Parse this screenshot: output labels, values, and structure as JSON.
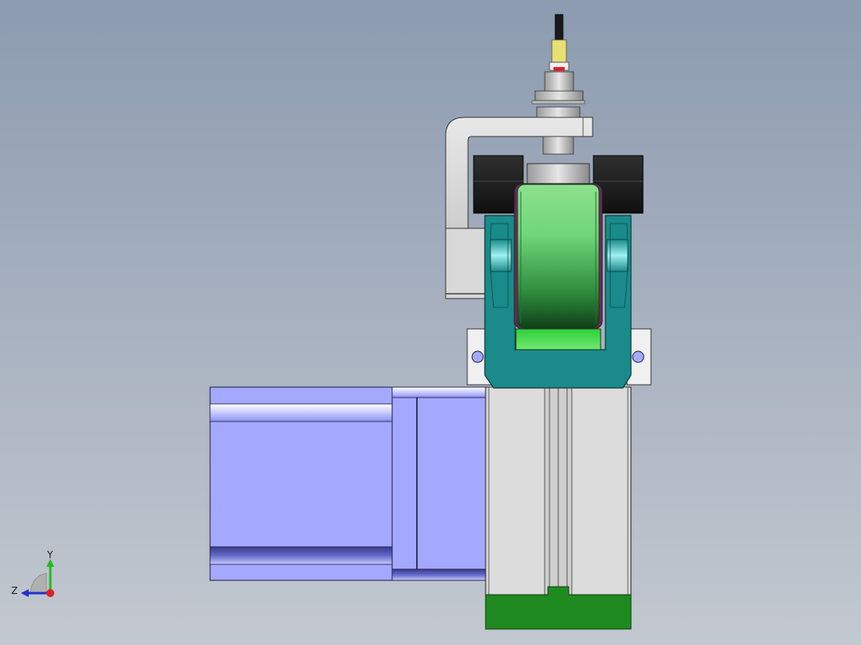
{
  "viewport": {
    "background_top": "#8c9bb0",
    "background_bottom": "#c3c8d0"
  },
  "model": {
    "parts": [
      "motor",
      "linear-module",
      "wheel-bracket",
      "polyurethane-wheel",
      "proximity-sensor",
      "sensor-bracket",
      "rubber-blocks",
      "mounting-flange"
    ],
    "colors": {
      "motor": "#a5a8ff",
      "bracket": "#1a8a8a",
      "wheel": "#5fcf6f",
      "module_base": "#1f8a1f",
      "module_body": "#d8d8d8",
      "blocks": "#1c1c1c",
      "sensor_tip": "#e8e070"
    }
  },
  "triad": {
    "y_label": "Y",
    "z_label": "Z",
    "y_color": "#22bb22",
    "z_color": "#2233cc",
    "x_color": "#dd2222"
  }
}
